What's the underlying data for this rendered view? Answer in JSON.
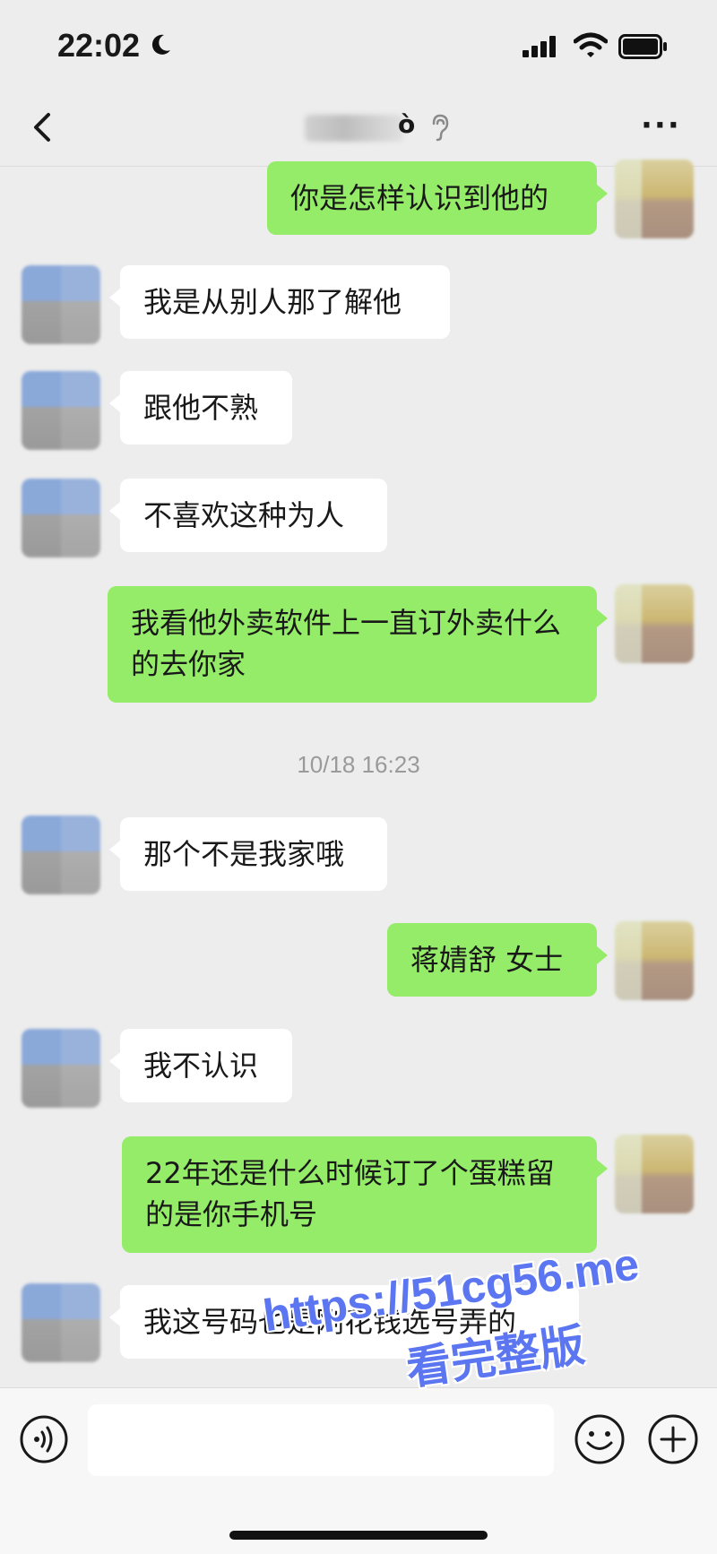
{
  "status_bar": {
    "time": "22:02",
    "moon_icon": "moon-icon",
    "signal_icon": "signal-icon",
    "wifi_icon": "wifi-icon",
    "battery_icon": "battery-icon"
  },
  "nav": {
    "back_icon": "chevron-left-icon",
    "title_visible_glyph": "ò",
    "title_icon": "ear-icon",
    "more_icon": "more-icon",
    "more_label": "···"
  },
  "messages": [
    {
      "side": "out",
      "text": "你是怎样认识到他的"
    },
    {
      "side": "in",
      "text": "我是从别人那了解他"
    },
    {
      "side": "in",
      "text": "跟他不熟"
    },
    {
      "side": "in",
      "text": "不喜欢这种为人"
    },
    {
      "side": "out",
      "text": "我看他外卖软件上一直订外卖什么的去你家"
    },
    {
      "side": "in",
      "text": "那个不是我家哦"
    },
    {
      "side": "out",
      "text": "蒋婧舒 女士"
    },
    {
      "side": "in",
      "text": "我不认识"
    },
    {
      "side": "out",
      "text": "22年还是什么时候订了个蛋糕留的是你手机号"
    },
    {
      "side": "in",
      "text": "我这号码也是刚花钱选号弄的"
    }
  ],
  "timestamp": "10/18 16:23",
  "input_bar": {
    "voice_icon": "voice-icon",
    "emoji_icon": "emoji-icon",
    "plus_icon": "plus-icon"
  },
  "watermark": {
    "line1": "https://51cg56.me",
    "line2": "看完整版"
  },
  "colors": {
    "background": "#ededed",
    "bubble_out": "#95ec69",
    "bubble_in": "#ffffff",
    "watermark": "#5b76f0"
  }
}
